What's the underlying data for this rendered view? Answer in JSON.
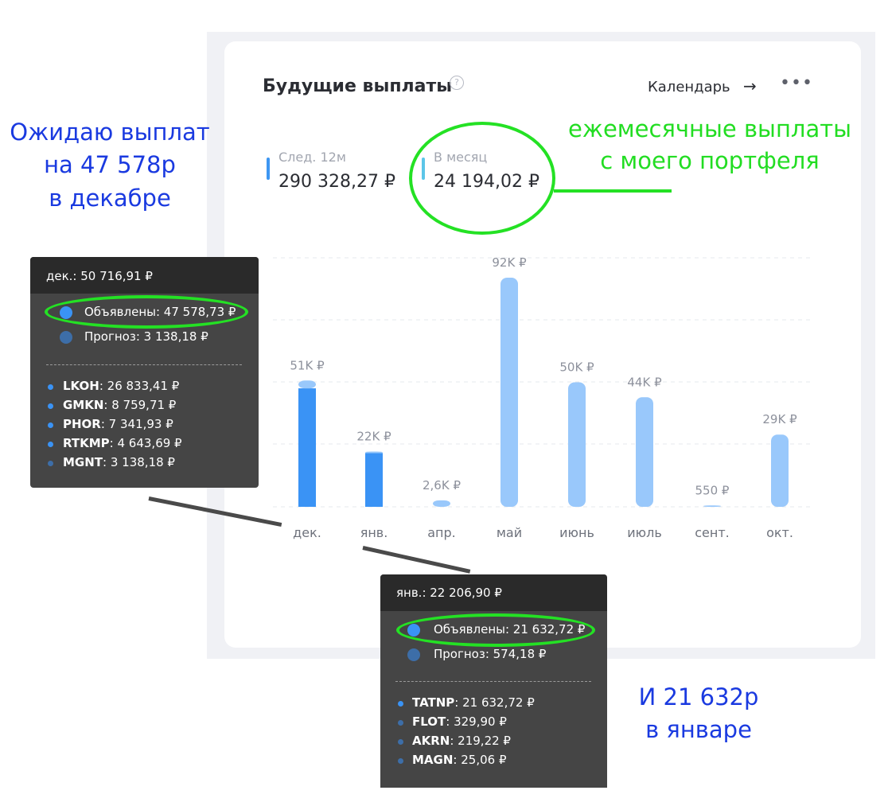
{
  "widget": {
    "title": "Будущие выплаты",
    "help_icon": "?",
    "calendar_link": "Календарь",
    "arrow_icon": "→",
    "more_icon": "•••"
  },
  "metrics": [
    {
      "label": "След. 12м",
      "value": "290 328,27 ₽",
      "color": "#3d96f2"
    },
    {
      "label": "В месяц",
      "value": "24 194,02 ₽",
      "color": "#5cc6e8"
    }
  ],
  "chart_data": {
    "type": "bar",
    "categories": [
      "дек.",
      "янв.",
      "апр.",
      "май",
      "июнь",
      "июль",
      "сент.",
      "окт."
    ],
    "series": [
      {
        "values": [
          47578.73,
          21632.72,
          0,
          0,
          0,
          0,
          0,
          0
        ],
        "color": "#3a93f5"
      },
      {
        "values": [
          3138.18,
          574.18,
          2600,
          92000,
          50000,
          44000,
          550,
          29000
        ],
        "color": "#99c8fb"
      }
    ],
    "data_labels": [
      "51K ₽",
      "22K ₽",
      "2,6K ₽",
      "92K ₽",
      "50K ₽",
      "44K ₽",
      "550 ₽",
      "29K ₽"
    ],
    "ylim": [
      0,
      100000
    ],
    "grid": true,
    "legend": "none"
  },
  "tooltip_dec": {
    "header": "дек.: 50 716,91 ₽",
    "declared": "Объявлены: 47 578,73 ₽",
    "forecast": "Прогноз: 3 138,18 ₽",
    "items": [
      {
        "ticker": "LKOH",
        "value": ": 26 833,41 ₽"
      },
      {
        "ticker": "GMKN",
        "value": ": 8 759,71 ₽"
      },
      {
        "ticker": "PHOR",
        "value": ": 7 341,93 ₽"
      },
      {
        "ticker": "RTKMP",
        "value": ": 4 643,69 ₽"
      },
      {
        "ticker": "MGNT",
        "value": ": 3 138,18 ₽"
      }
    ]
  },
  "tooltip_jan": {
    "header": "янв.: 22 206,90 ₽",
    "declared": "Объявлены: 21 632,72 ₽",
    "forecast": "Прогноз: 574,18 ₽",
    "items": [
      {
        "ticker": "TATNP",
        "value": ": 21 632,72 ₽"
      },
      {
        "ticker": "FLOT",
        "value": ": 329,90 ₽"
      },
      {
        "ticker": "AKRN",
        "value": ": 219,22 ₽"
      },
      {
        "ticker": "MAGN",
        "value": ": 25,06 ₽"
      }
    ]
  },
  "annotations": {
    "left_note": [
      "Ожидаю выплат",
      "на 47 578р",
      "в декабре"
    ],
    "right_note": [
      "ежемесячные выплаты",
      "с моего портфеля"
    ],
    "bottom_note": [
      "И 21 632р",
      "в январе"
    ]
  },
  "colors": {
    "declared_dot": "#3a93f5",
    "forecast_dot": "#3d6ea8",
    "annotation_blue": "#1a3ae0",
    "annotation_green": "#22dd22"
  }
}
